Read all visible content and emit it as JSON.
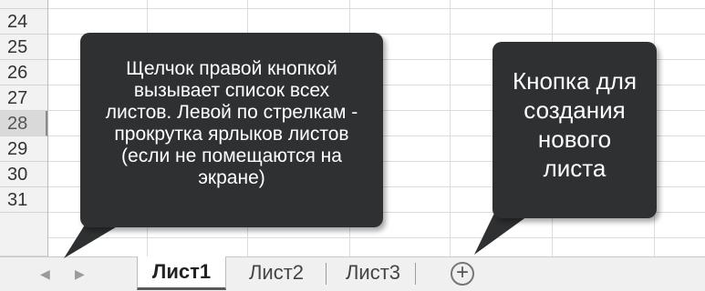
{
  "grid": {
    "row_headers": [
      {
        "label": "24",
        "active": false
      },
      {
        "label": "25",
        "active": false
      },
      {
        "label": "26",
        "active": false
      },
      {
        "label": "27",
        "active": false
      },
      {
        "label": "28",
        "active": true
      },
      {
        "label": "29",
        "active": false
      },
      {
        "label": "30",
        "active": false
      },
      {
        "label": "31",
        "active": false
      }
    ]
  },
  "tabs": {
    "nav_prev_icon": "triangle-left-icon",
    "nav_next_icon": "triangle-right-icon",
    "sheets": [
      {
        "label": "Лист1",
        "active": true
      },
      {
        "label": "Лист2",
        "active": false
      },
      {
        "label": "Лист3",
        "active": false
      }
    ],
    "add_sheet_icon": "plus-circle-icon",
    "add_sheet_glyph": "+"
  },
  "callouts": {
    "left": "Щелчок правой кнопкой\nвызывает список всех\nлистов. Левой по стрелкам -\nпрокрутка ярлыков листов\n(если не помещаются на\nэкране)",
    "right": "Кнопка для\nсоздания\nнового\nлиста"
  },
  "colors": {
    "callout_bg": "#2e3032",
    "callout_text": "#ffffff",
    "tabbar_bg": "#f0f0f0",
    "header_bg": "#f2f2f2"
  }
}
